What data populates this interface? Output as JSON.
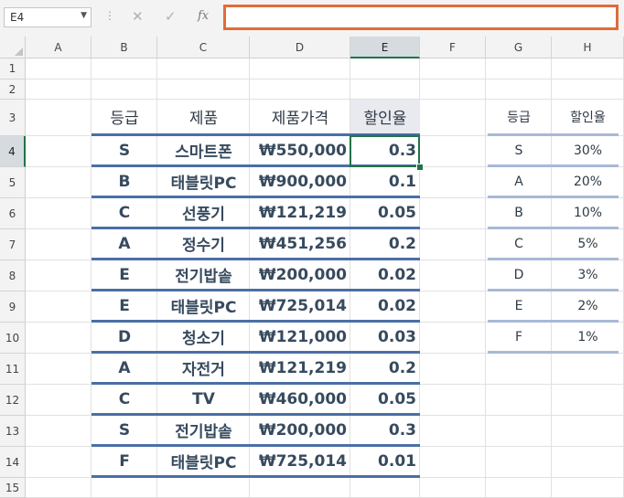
{
  "name_box": {
    "value": "E4"
  },
  "formula_bar": {
    "value": "",
    "cancel_icon": "✕",
    "enter_icon": "✓",
    "fx_icon": "fx"
  },
  "columns": [
    "A",
    "B",
    "C",
    "D",
    "E",
    "F",
    "G",
    "H"
  ],
  "rows": [
    "1",
    "2",
    "3",
    "4",
    "5",
    "6",
    "7",
    "8",
    "9",
    "10",
    "11",
    "12",
    "13",
    "14",
    "15"
  ],
  "selected": {
    "column": "E",
    "row": "4"
  },
  "table": {
    "headers": [
      "등급",
      "제품",
      "제품가격",
      "할인율"
    ],
    "rows": [
      [
        "S",
        "스마트폰",
        "₩550,000",
        "0.3"
      ],
      [
        "B",
        "태블릿PC",
        "₩900,000",
        "0.1"
      ],
      [
        "C",
        "선풍기",
        "₩121,219",
        "0.05"
      ],
      [
        "A",
        "정수기",
        "₩451,256",
        "0.2"
      ],
      [
        "E",
        "전기밥솥",
        "₩200,000",
        "0.02"
      ],
      [
        "E",
        "태블릿PC",
        "₩725,014",
        "0.02"
      ],
      [
        "D",
        "청소기",
        "₩121,000",
        "0.03"
      ],
      [
        "A",
        "자전거",
        "₩121,219",
        "0.2"
      ],
      [
        "C",
        "TV",
        "₩460,000",
        "0.05"
      ],
      [
        "S",
        "전기밥솥",
        "₩200,000",
        "0.3"
      ],
      [
        "F",
        "태블릿PC",
        "₩725,014",
        "0.01"
      ]
    ]
  },
  "lookup": {
    "headers": [
      "등급",
      "할인율"
    ],
    "rows": [
      [
        "S",
        "30%"
      ],
      [
        "A",
        "20%"
      ],
      [
        "B",
        "10%"
      ],
      [
        "C",
        "5%"
      ],
      [
        "D",
        "3%"
      ],
      [
        "E",
        "2%"
      ],
      [
        "F",
        "1%"
      ]
    ]
  },
  "colors": {
    "accent": "#217346",
    "table_border": "#4a6fa5",
    "lookup_border": "#a9b8d6",
    "highlight": "#e06c3a"
  }
}
